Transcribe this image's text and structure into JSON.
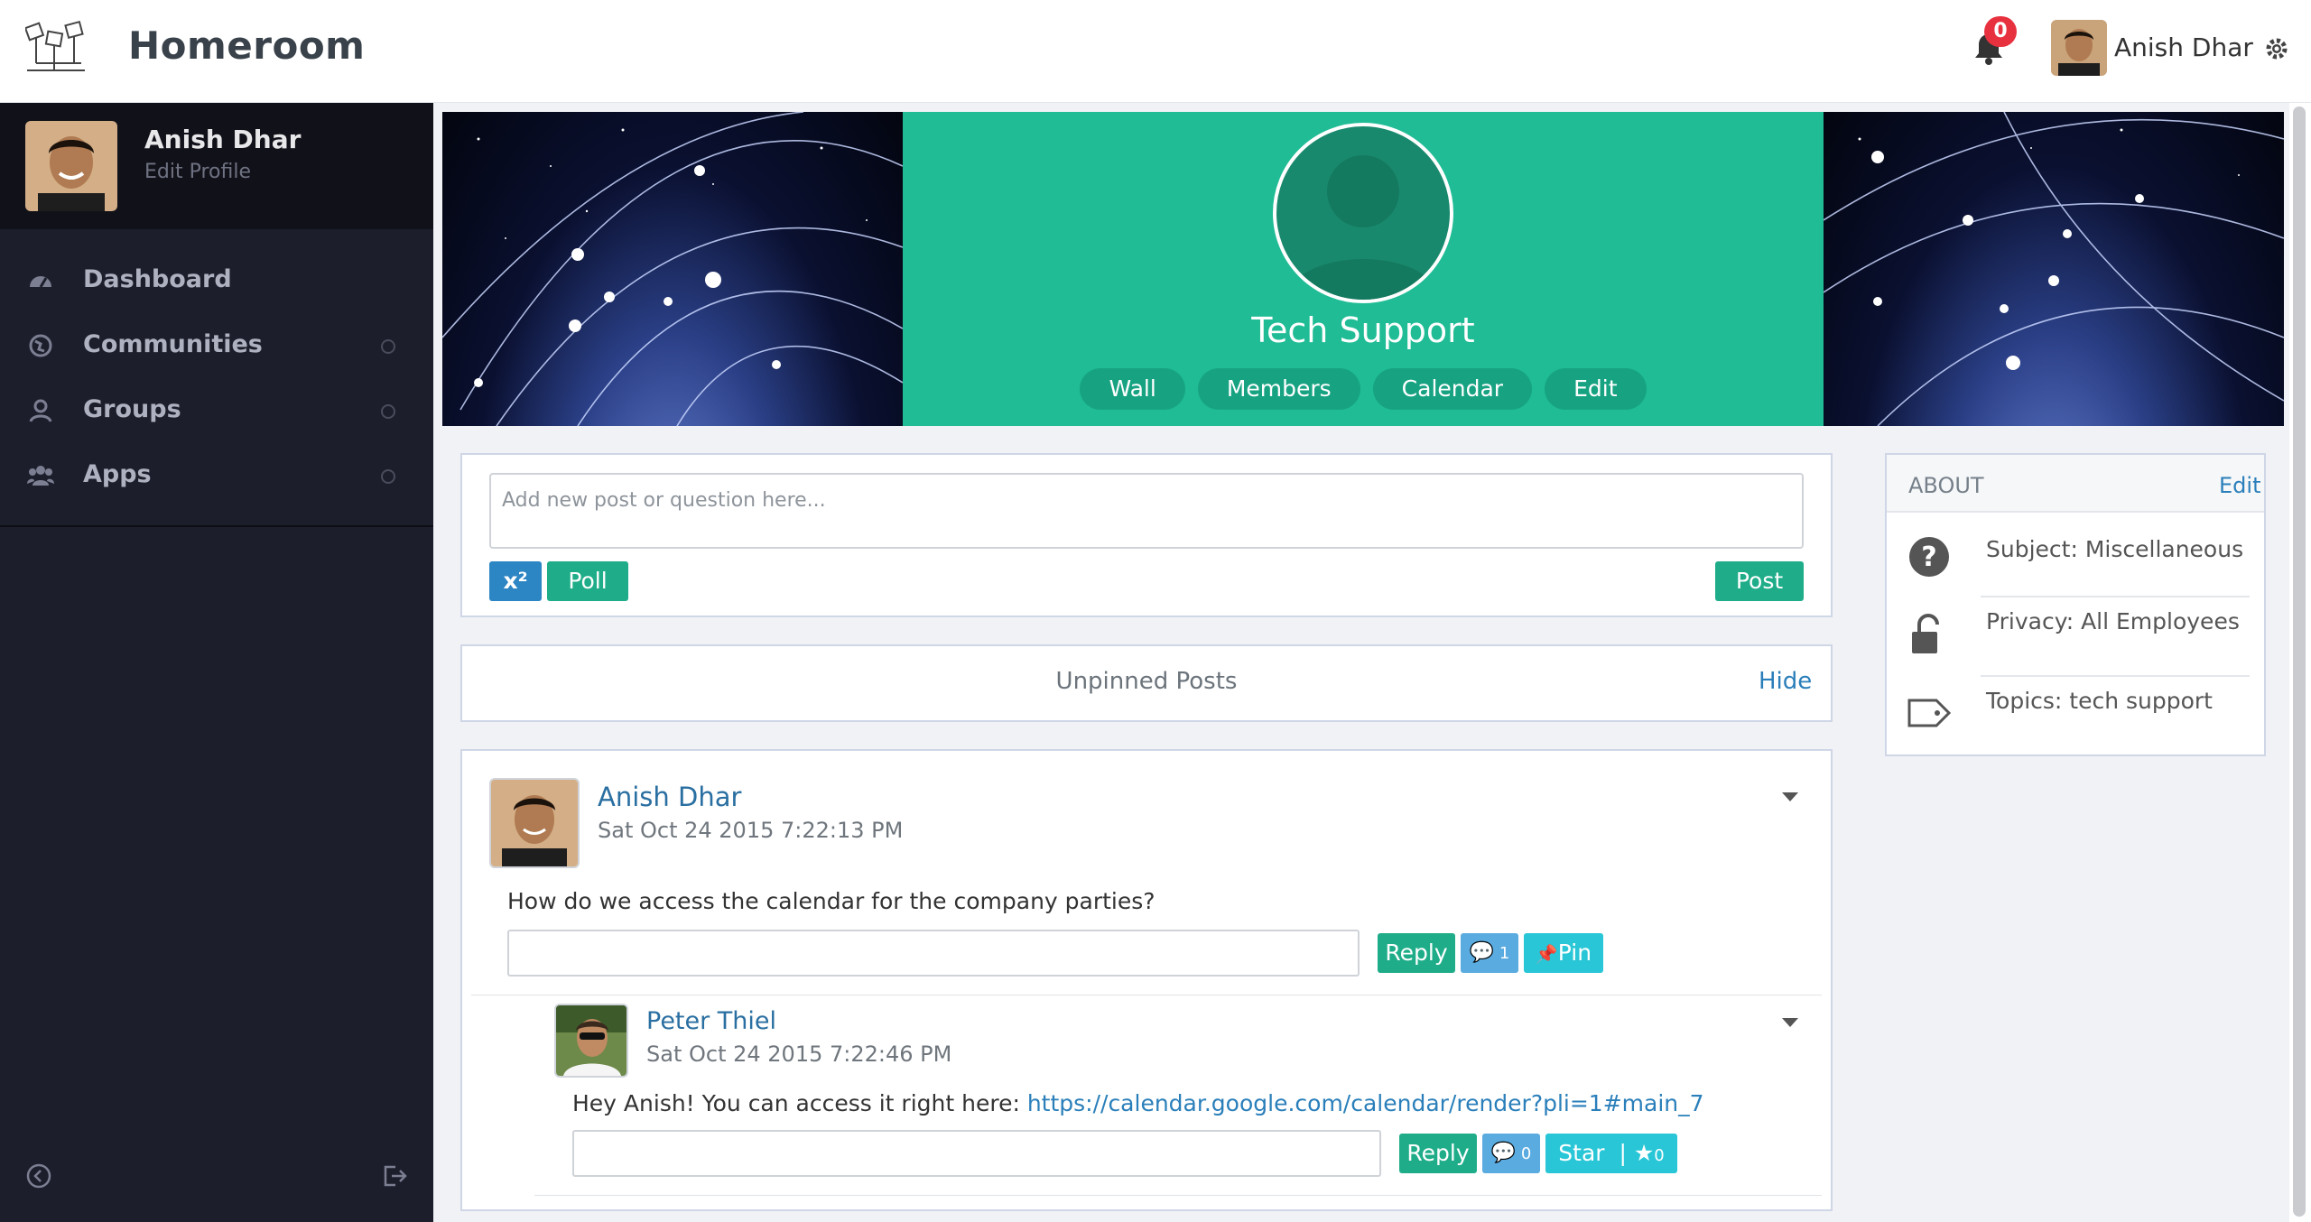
{
  "app": {
    "brand": "Homeroom",
    "notifications": "0",
    "user_name": "Anish Dhar"
  },
  "sidebar": {
    "user_name": "Anish Dhar",
    "edit_profile": "Edit Profile",
    "items": [
      {
        "label": "Dashboard",
        "icon": "dashboard-icon"
      },
      {
        "label": "Communities",
        "icon": "globe-icon"
      },
      {
        "label": "Groups",
        "icon": "user-icon"
      },
      {
        "label": "Apps",
        "icon": "users-icon"
      }
    ]
  },
  "cover": {
    "title": "Tech Support",
    "tabs": [
      "Wall",
      "Members",
      "Calendar",
      "Edit"
    ],
    "accent": "#1fbc95"
  },
  "composer": {
    "placeholder": "Add new post or question here...",
    "superscript_btn": "x²",
    "poll_btn": "Poll",
    "post_btn": "Post"
  },
  "unpinned": {
    "title": "Unpinned Posts",
    "hide": "Hide"
  },
  "post": {
    "author": "Anish Dhar",
    "timestamp": "Sat Oct 24 2015 7:22:13 PM",
    "body": "How do we access the calendar for the company parties?",
    "reply_btn": "Reply",
    "comment_count": "1",
    "pin_btn": "Pin"
  },
  "reply": {
    "author": "Peter Thiel",
    "timestamp": "Sat Oct 24 2015 7:22:46 PM",
    "body": "Hey Anish! You can access it right here: ",
    "link": "https://calendar.google.com/calendar/render?pli=1#main_7",
    "reply_btn": "Reply",
    "comment_count": "0",
    "star_btn": "Star",
    "star_count": "0"
  },
  "about": {
    "title": "ABOUT",
    "edit": "Edit",
    "subject": "Subject:  Miscellaneous",
    "privacy": "Privacy:  All Employees",
    "topics": "Topics:  tech support"
  }
}
